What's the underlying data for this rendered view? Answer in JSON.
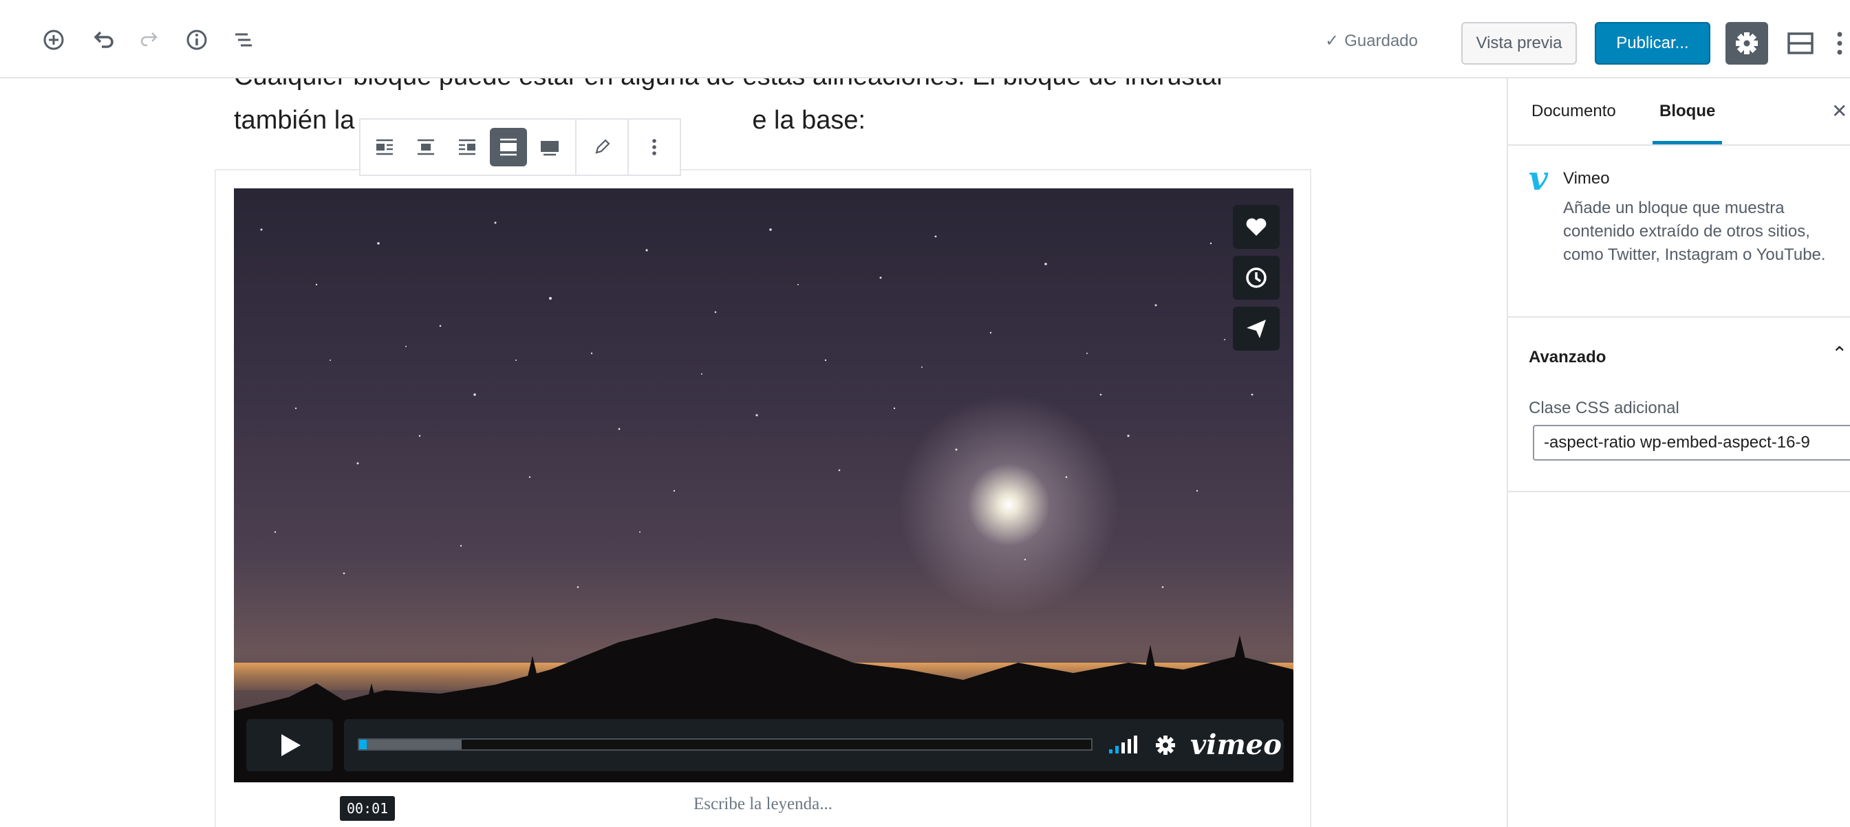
{
  "toolbar": {
    "saved_label": "Guardado",
    "preview_label": "Vista previa",
    "publish_label": "Publicar..."
  },
  "editor": {
    "paragraph_line1": "Cualquier bloque puede estar en alguna de estas alineaciones. El bloque de incrustar",
    "paragraph_line2_start": "también la",
    "paragraph_line2_end": "e la base:",
    "caption_placeholder": "Escribe la leyenda..."
  },
  "video": {
    "current_time": "00:01",
    "brand": "vimeo",
    "progress_played": 0.01,
    "progress_buffered": 0.14
  },
  "sidebar": {
    "tabs": [
      {
        "label": "Documento"
      },
      {
        "label": "Bloque"
      }
    ],
    "block": {
      "name": "Vimeo",
      "icon_letter": "v",
      "description": "Añade un bloque que muestra contenido extraído de otros sitios, como Twitter, Instagram o YouTube."
    },
    "advanced": {
      "title": "Avanzado",
      "css_label": "Clase CSS adicional",
      "css_value": "-aspect-ratio wp-embed-aspect-16-9"
    }
  },
  "colors": {
    "primary": "#0085ba",
    "vimeo_blue": "#1ab7ea",
    "progress_blue": "#00adef"
  }
}
